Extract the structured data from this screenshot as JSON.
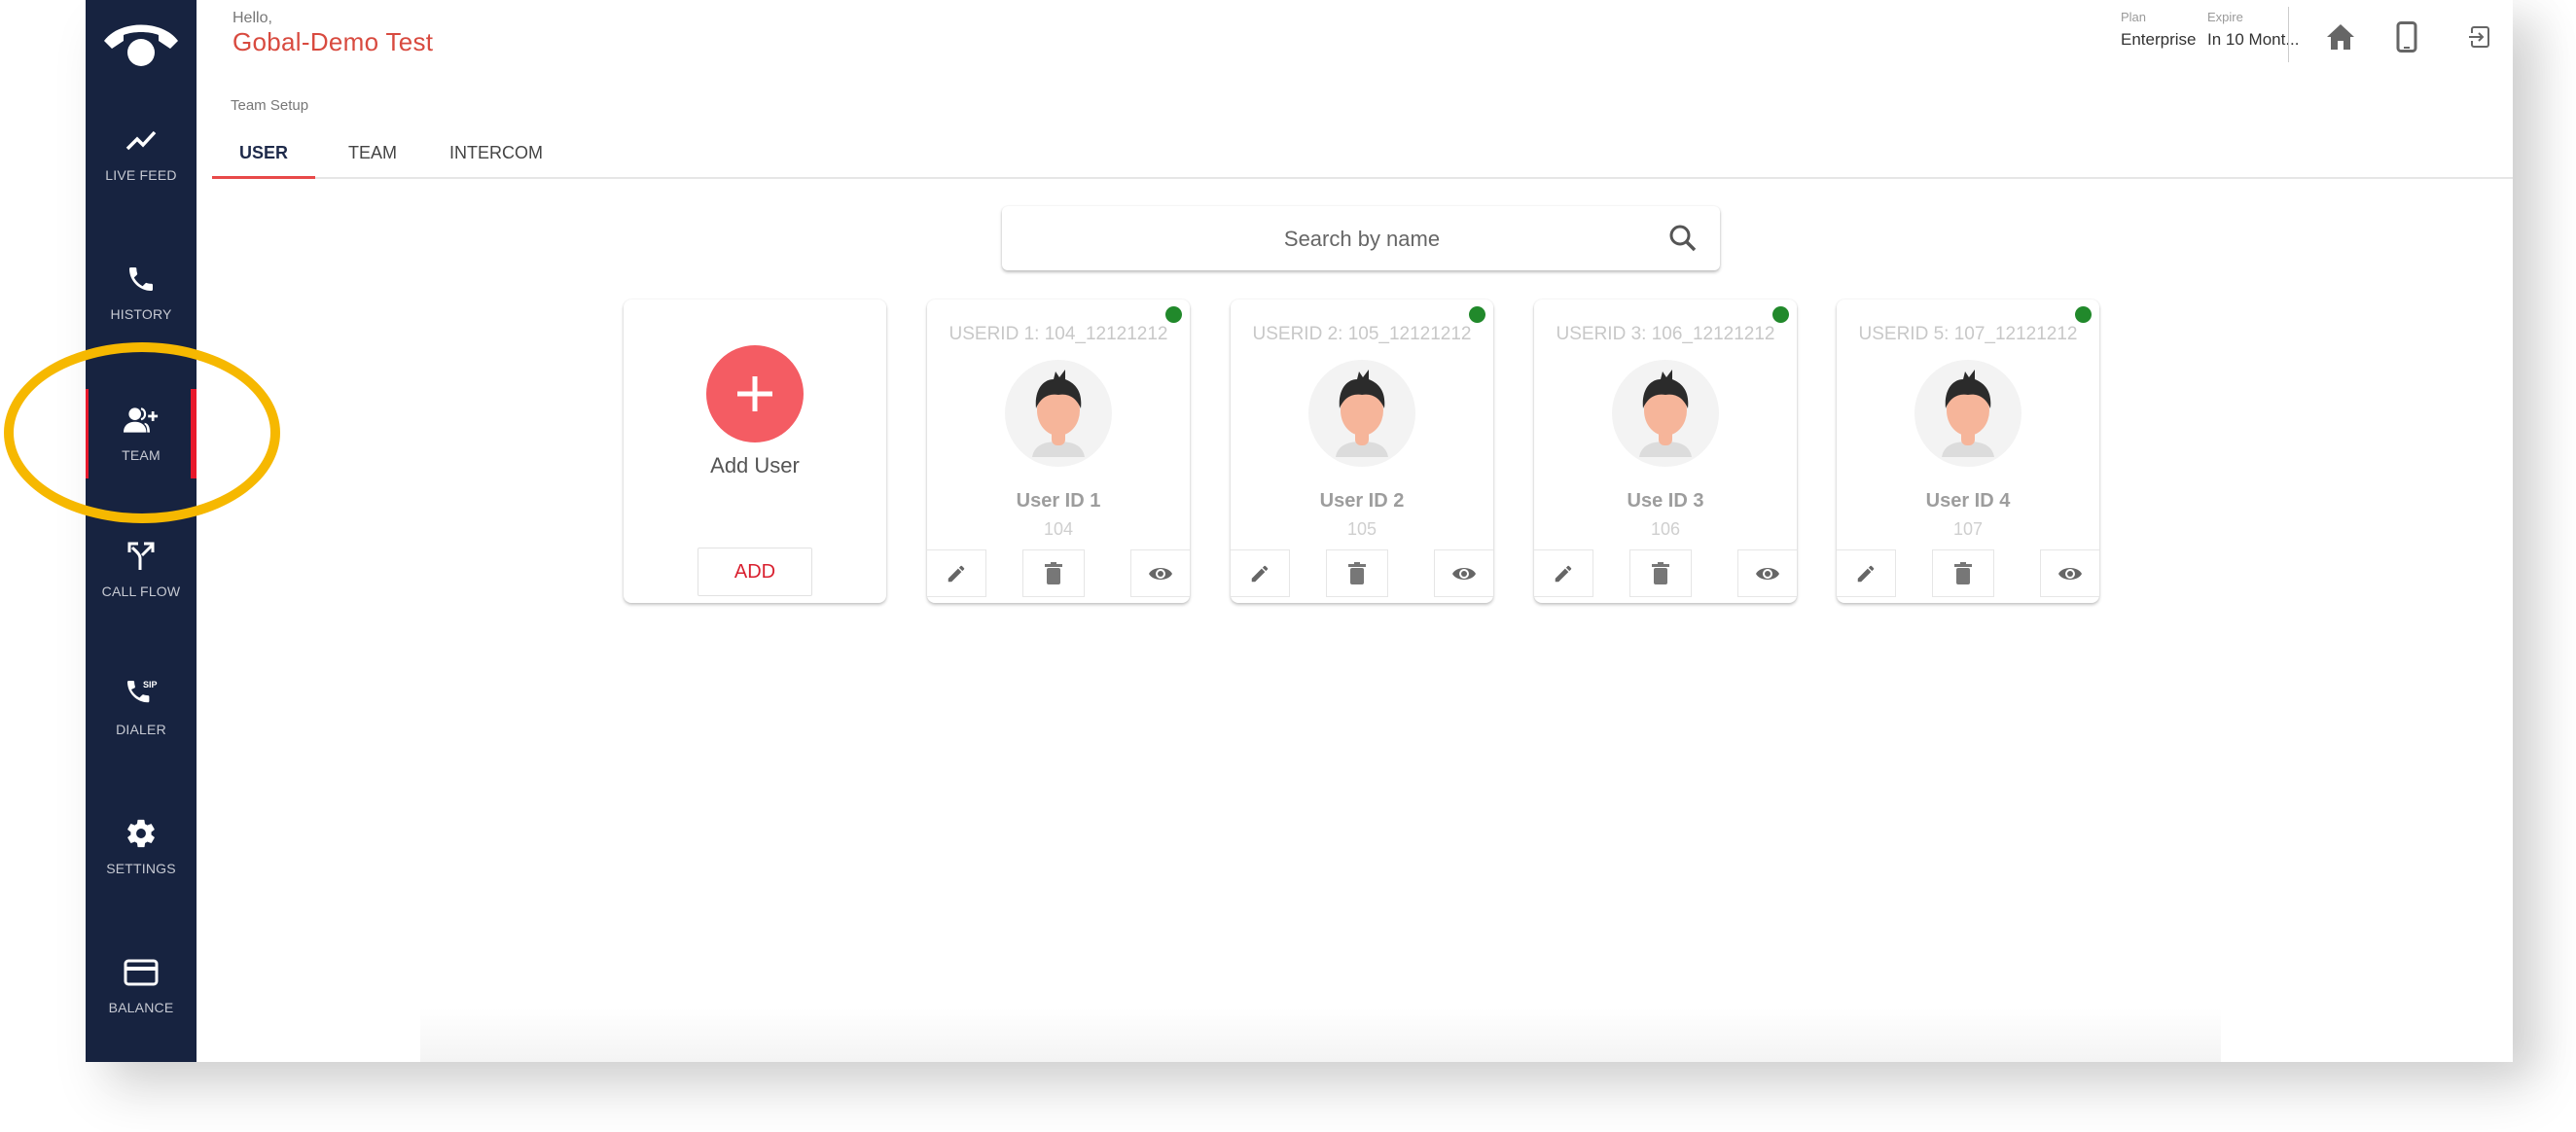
{
  "sidebar": {
    "logo": "phone-logo-icon",
    "items": [
      {
        "label": "LIVE FEED",
        "icon": "trending-up-icon",
        "active": false
      },
      {
        "label": "HISTORY",
        "icon": "phone-icon",
        "active": false
      },
      {
        "label": "TEAM",
        "icon": "group-add-icon",
        "active": true
      },
      {
        "label": "CALL FLOW",
        "icon": "call-split-icon",
        "active": false
      },
      {
        "label": "DIALER",
        "icon": "sip-phone-icon",
        "active": false
      },
      {
        "label": "SETTINGS",
        "icon": "gear-icon",
        "active": false
      },
      {
        "label": "BALANCE",
        "icon": "credit-card-icon",
        "active": false
      }
    ]
  },
  "header": {
    "greeting": "Hello,",
    "username": "Gobal-Demo Test",
    "plan_label": "Plan",
    "plan_value": "Enterprise",
    "expire_label": "Expire",
    "expire_value": "In 10 Mont...",
    "icons": [
      "home-icon",
      "mobile-icon",
      "logout-icon"
    ]
  },
  "page": {
    "section_label": "Team Setup",
    "tabs": [
      {
        "label": "USER",
        "active": true
      },
      {
        "label": "TEAM",
        "active": false
      },
      {
        "label": "INTERCOM",
        "active": false
      }
    ]
  },
  "search": {
    "placeholder": "Search by name",
    "value": ""
  },
  "add_card": {
    "title": "Add User",
    "button_label": "ADD"
  },
  "users": [
    {
      "userid_line": "USERID 1: 104_12121212",
      "name": "User ID 1",
      "extension": "104",
      "status": "online"
    },
    {
      "userid_line": "USERID 2: 105_12121212",
      "name": "User ID 2",
      "extension": "105",
      "status": "online"
    },
    {
      "userid_line": "USERID 3: 106_12121212",
      "name": "Use ID 3",
      "extension": "106",
      "status": "online"
    },
    {
      "userid_line": "USERID 5: 107_12121212",
      "name": "User ID 4",
      "extension": "107",
      "status": "online"
    }
  ],
  "colors": {
    "sidebar_bg": "#172340",
    "accent_red": "#e8192c",
    "username_red": "#d84a3f",
    "add_circle": "#f45c63",
    "status_online": "#21892b",
    "highlight": "#f6b800"
  }
}
